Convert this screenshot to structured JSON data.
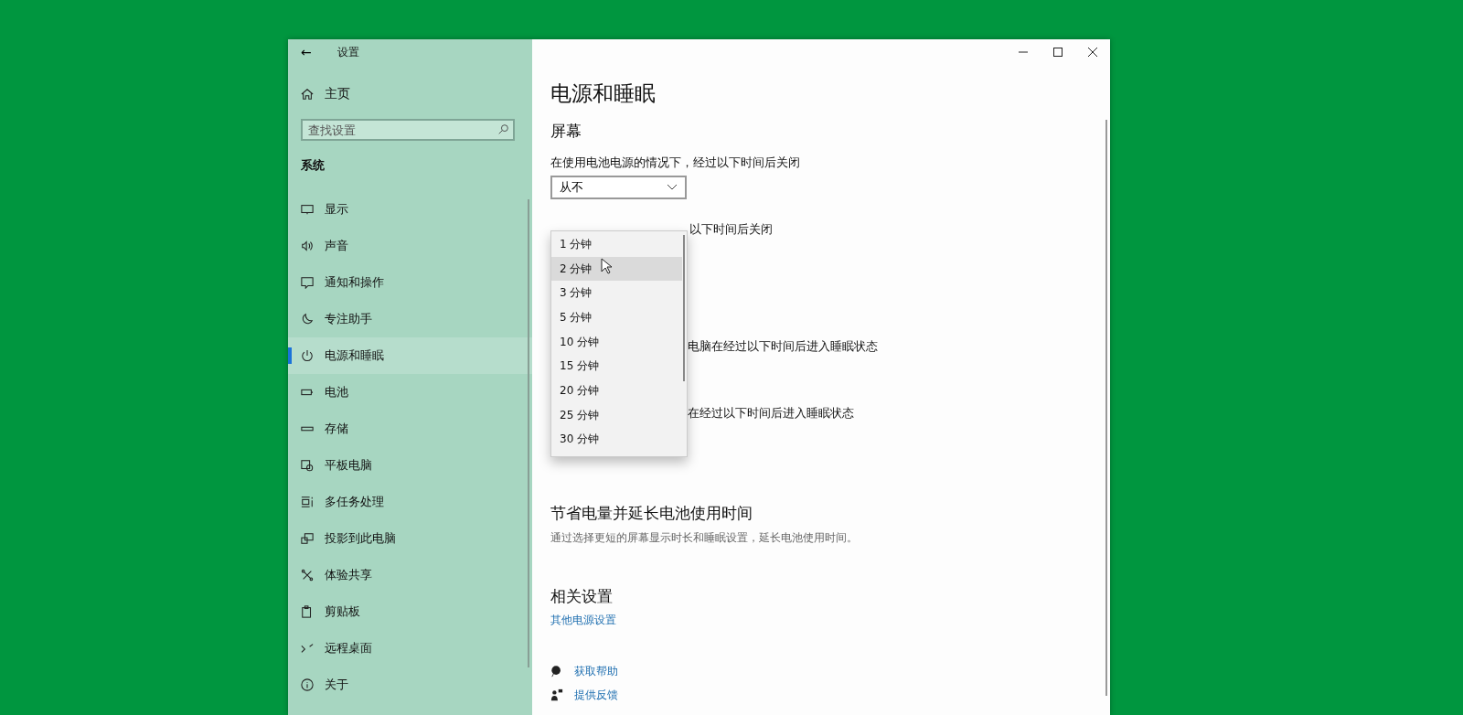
{
  "window": {
    "title": "设置",
    "back": "←"
  },
  "sidebar": {
    "home": "主页",
    "search": {
      "placeholder": "查找设置"
    },
    "section": "系统",
    "items": [
      {
        "label": "显示",
        "selected": false
      },
      {
        "label": "声音",
        "selected": false
      },
      {
        "label": "通知和操作",
        "selected": false
      },
      {
        "label": "专注助手",
        "selected": false
      },
      {
        "label": "电源和睡眠",
        "selected": true
      },
      {
        "label": "电池",
        "selected": false
      },
      {
        "label": "存储",
        "selected": false
      },
      {
        "label": "平板电脑",
        "selected": false
      },
      {
        "label": "多任务处理",
        "selected": false
      },
      {
        "label": "投影到此电脑",
        "selected": false
      },
      {
        "label": "体验共享",
        "selected": false
      },
      {
        "label": "剪贴板",
        "selected": false
      },
      {
        "label": "远程桌面",
        "selected": false
      },
      {
        "label": "关于",
        "selected": false
      }
    ]
  },
  "page": {
    "title": "电源和睡眠",
    "screen_heading": "屏幕",
    "battery_label": "在使用电池电源的情况下，经过以下时间后关闭",
    "battery_value": "从不",
    "plugged_label_visible": "以下时间后关闭",
    "sleep_label_1_visible": "电脑在经过以下时间后进入睡眠状态",
    "sleep_label_2_visible": "在经过以下时间后进入睡眠状态",
    "dropdown": [
      {
        "label": "1 分钟",
        "highlighted": false
      },
      {
        "label": "2 分钟",
        "highlighted": true
      },
      {
        "label": "3 分钟",
        "highlighted": false
      },
      {
        "label": "5 分钟",
        "highlighted": false
      },
      {
        "label": "10 分钟",
        "highlighted": false
      },
      {
        "label": "15 分钟",
        "highlighted": false
      },
      {
        "label": "20 分钟",
        "highlighted": false
      },
      {
        "label": "25 分钟",
        "highlighted": false
      },
      {
        "label": "30 分钟",
        "highlighted": false
      }
    ],
    "save_heading": "节省电量并延长电池使用时间",
    "save_desc": "通过选择更短的屏幕显示时长和睡眠设置，延长电池使用时间。",
    "related_heading": "相关设置",
    "related_link": "其他电源设置",
    "help_links": [
      {
        "label": "获取帮助"
      },
      {
        "label": "提供反馈"
      }
    ]
  }
}
